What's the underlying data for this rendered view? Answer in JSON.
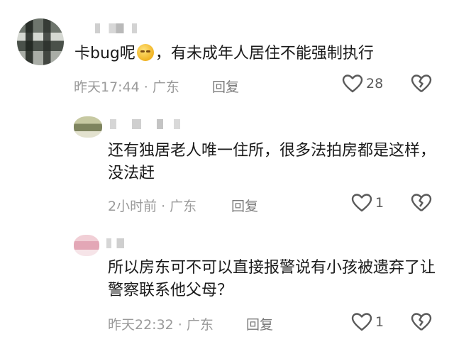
{
  "comments": [
    {
      "body": "卡bug呢",
      "body_tail": "，有未成年人居住不能强制执行",
      "emoji": "emoji-icon",
      "time": "昨天17:44",
      "region": "广东",
      "reply_label": "回复",
      "likes": "28"
    },
    {
      "body": "还有独居老人唯一住所，很多法拍房都是这样，没法赶",
      "time": "2小时前",
      "region": "广东",
      "reply_label": "回复",
      "likes": "1"
    },
    {
      "body": "所以房东可不可以直接报警说有小孩被遗弃了让警察联系他父母？",
      "time": "昨天22:32",
      "region": "广东",
      "reply_label": "回复",
      "likes": "1"
    }
  ],
  "separator": "·",
  "colors": {
    "text": "#1a1a1a",
    "meta": "#9a9a9a"
  }
}
